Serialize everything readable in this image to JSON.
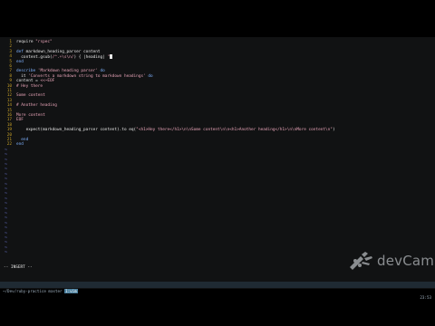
{
  "editor": {
    "lines": [
      {
        "n": "1",
        "segments": [
          {
            "c": "fn",
            "t": "require "
          },
          {
            "c": "str",
            "t": "\"rspec\""
          }
        ]
      },
      {
        "n": "2",
        "segments": []
      },
      {
        "n": "3",
        "segments": [
          {
            "c": "kw",
            "t": "def "
          },
          {
            "c": "fn",
            "t": "markdown_heading_parser "
          },
          {
            "c": "fn",
            "t": "content"
          }
        ]
      },
      {
        "n": "4",
        "segments": [
          {
            "c": "fn",
            "t": "  content.gsub("
          },
          {
            "c": "str",
            "t": "/^.+\\s\\n/"
          },
          {
            "c": "fn",
            "t": ") { |heading| "
          },
          {
            "c": "str",
            "t": "\""
          }
        ],
        "cursor": true
      },
      {
        "n": "5",
        "segments": [
          {
            "c": "kw",
            "t": "end"
          }
        ]
      },
      {
        "n": "6",
        "segments": []
      },
      {
        "n": "7",
        "segments": [
          {
            "c": "kw",
            "t": "describe "
          },
          {
            "c": "str",
            "t": "'Markdown heading parser'"
          },
          {
            "c": "kw",
            "t": " do"
          }
        ]
      },
      {
        "n": "8",
        "segments": [
          {
            "c": "fn",
            "t": "  it "
          },
          {
            "c": "str",
            "t": "'Converts a markdown string to markdown headings'"
          },
          {
            "c": "kw",
            "t": " do"
          }
        ]
      },
      {
        "n": "9",
        "segments": [
          {
            "c": "fn",
            "t": "content = "
          },
          {
            "c": "str",
            "t": "<<~EOF"
          }
        ]
      },
      {
        "n": "10",
        "segments": [
          {
            "c": "str",
            "t": "# Hey there"
          }
        ]
      },
      {
        "n": "11",
        "segments": []
      },
      {
        "n": "12",
        "segments": [
          {
            "c": "str",
            "t": "Some content"
          }
        ]
      },
      {
        "n": "13",
        "segments": []
      },
      {
        "n": "14",
        "segments": [
          {
            "c": "str",
            "t": "# Another heading"
          }
        ]
      },
      {
        "n": "15",
        "segments": []
      },
      {
        "n": "16",
        "segments": [
          {
            "c": "str",
            "t": "More content"
          }
        ]
      },
      {
        "n": "17",
        "segments": [
          {
            "c": "str",
            "t": "EOF"
          }
        ]
      },
      {
        "n": "18",
        "segments": []
      },
      {
        "n": "19",
        "segments": [
          {
            "c": "fn",
            "t": "    expect(markdown_heading_parser content).to eq("
          },
          {
            "c": "str",
            "t": "\"<h1>Hey there</h1>\\n\\nSome content\\n\\n<h1>Another heading</h1>\\n\\nMore content\\n\""
          },
          {
            "c": "fn",
            "t": ")"
          }
        ]
      },
      {
        "n": "20",
        "segments": []
      },
      {
        "n": "21",
        "segments": [
          {
            "c": "kw",
            "t": "  end"
          }
        ]
      },
      {
        "n": "22",
        "segments": [
          {
            "c": "kw",
            "t": "end"
          }
        ]
      }
    ],
    "tilde_char": "~",
    "tilde_count": 22
  },
  "mode": "-- INSERT --",
  "statusbar": {
    "path_prefix": "~/Dev/ruby-practice ",
    "segment_mid": "master",
    "segment_active": "1:vim",
    "time": "23:53"
  },
  "logo": {
    "text": "devCamp",
    "icon": "devcamp-knife-icon"
  },
  "colors": {
    "editor_bg": "#111213",
    "line_number": "#c9a227",
    "tilde": "#6b76d6",
    "keyword": "#7fb2ff",
    "string": "#e7a3b7",
    "statusbar_bg": "#1f2a33",
    "status_active_bg": "#4a7f9e"
  }
}
